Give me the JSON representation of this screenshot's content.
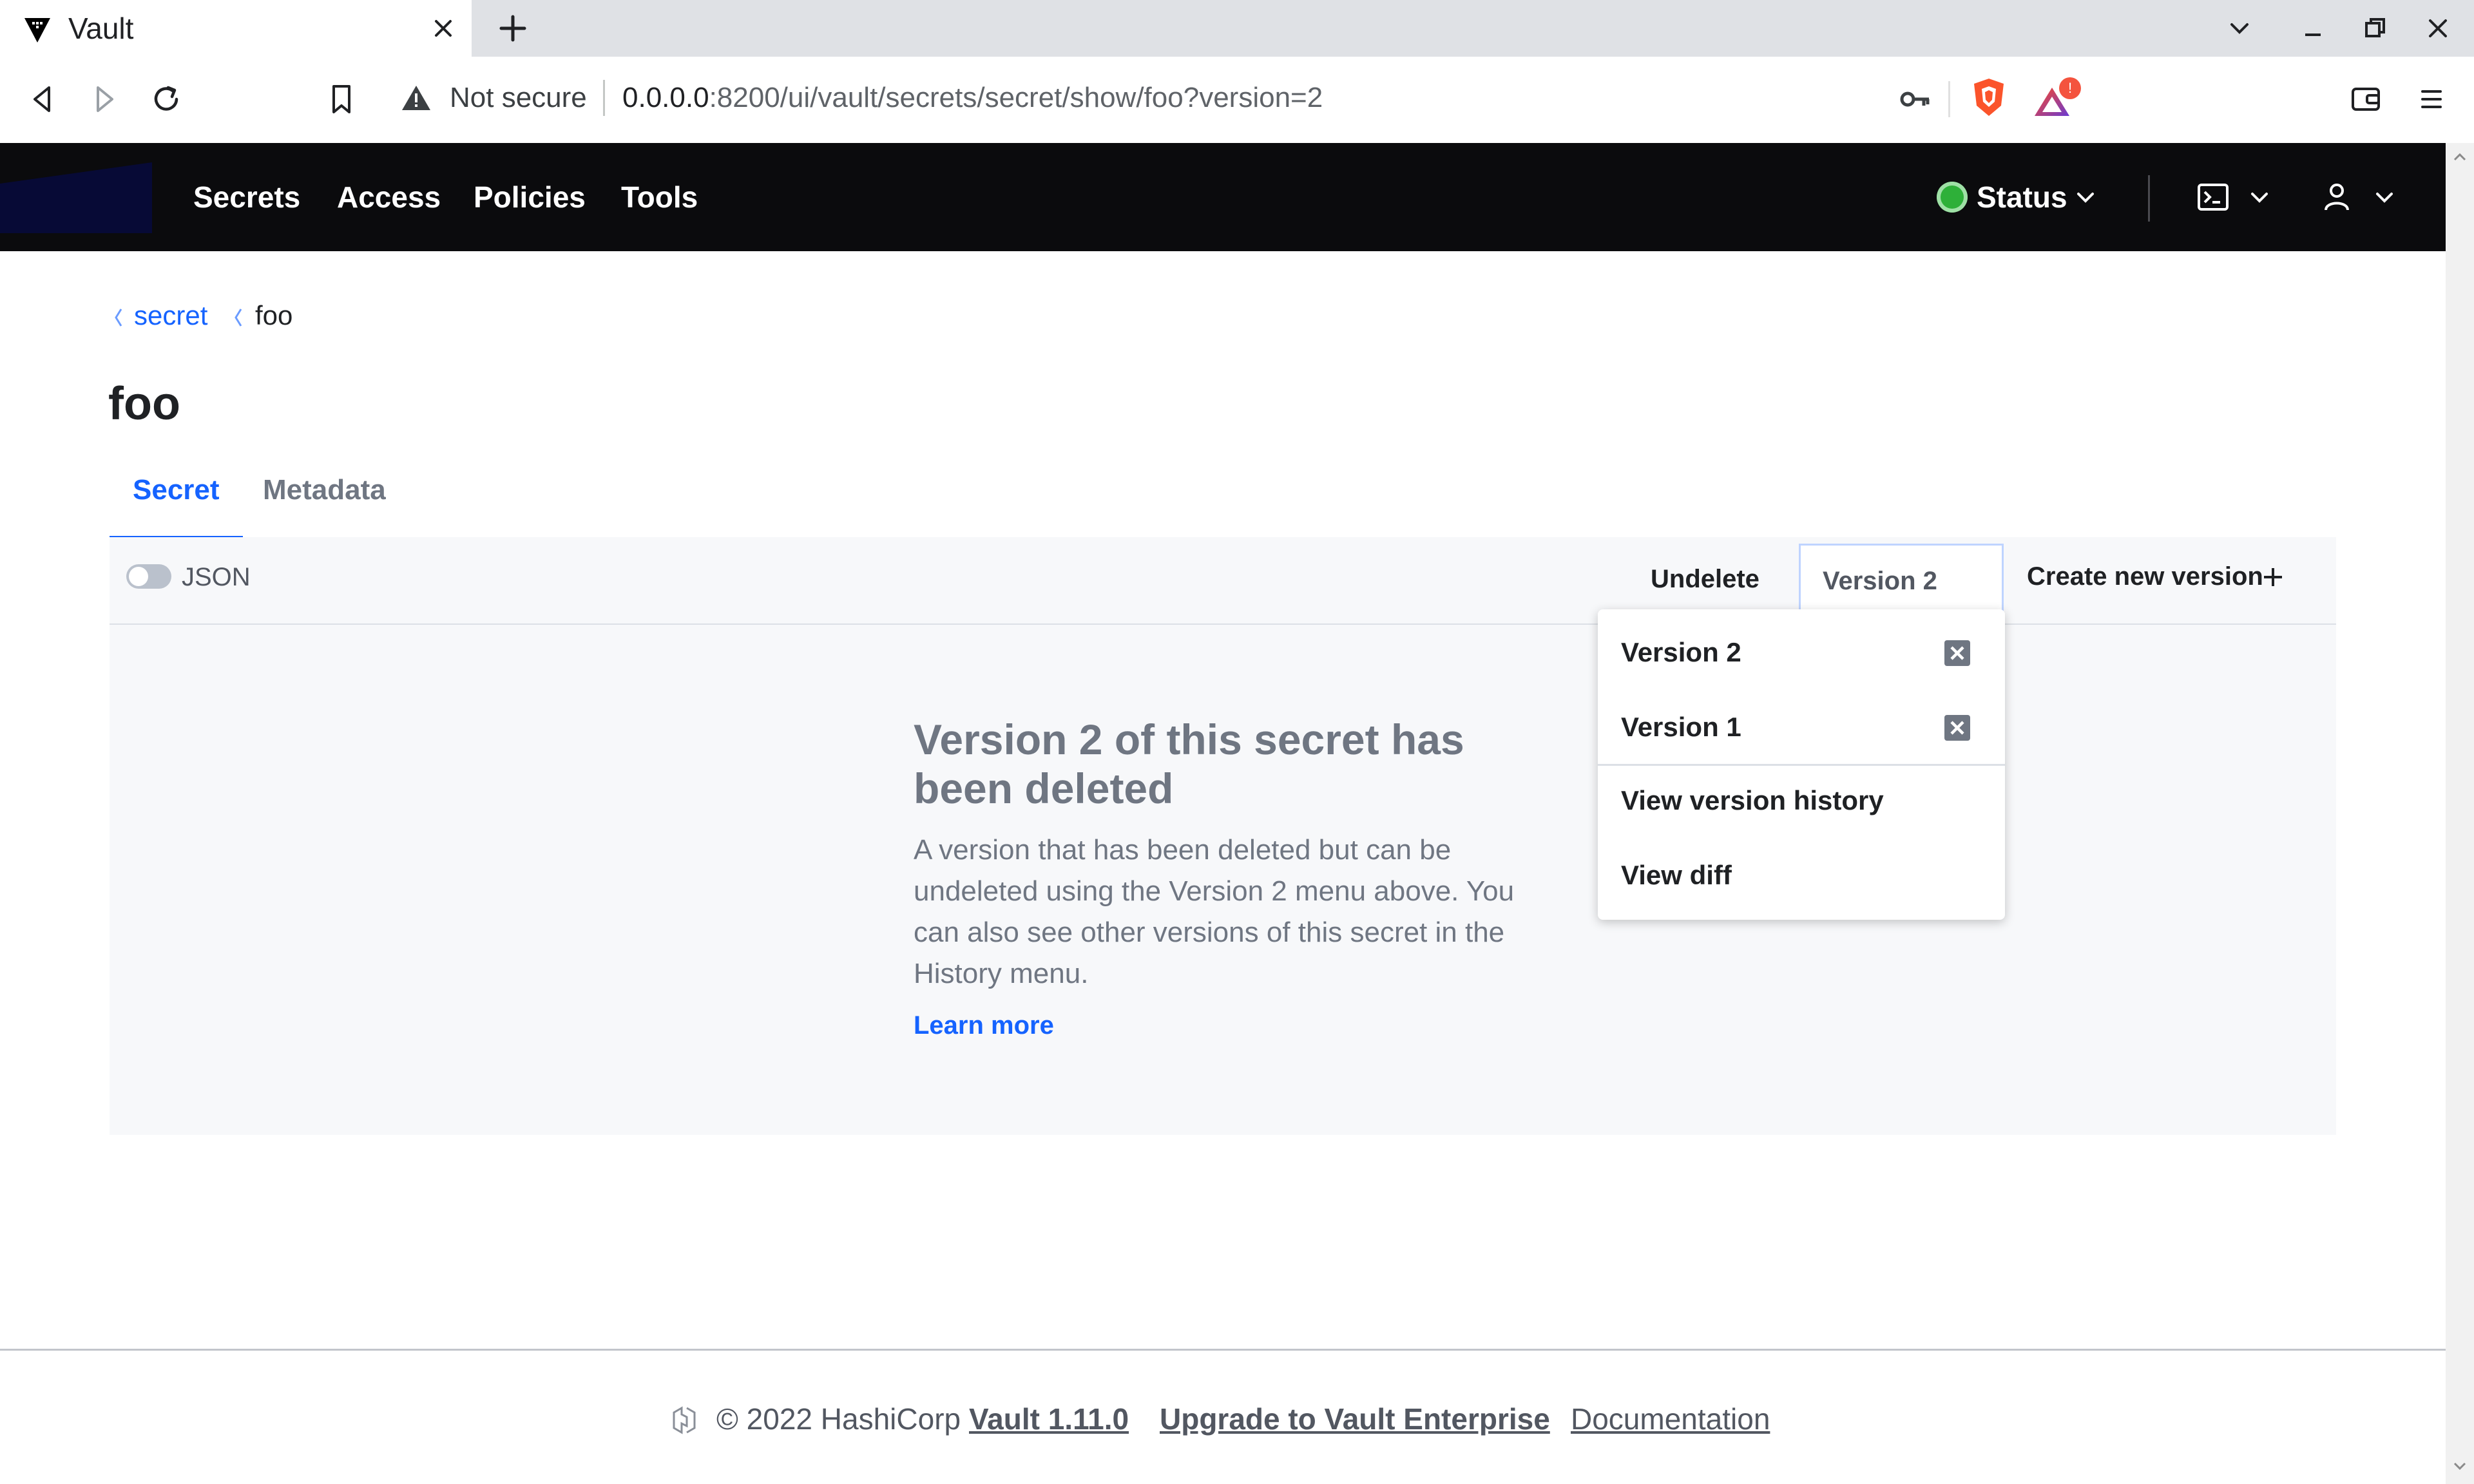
{
  "browser": {
    "tab_title": "Vault",
    "omnibox": {
      "security_label": "Not secure",
      "url_host": "0.0.0.0",
      "url_rest": ":8200/ui/vault/secrets/secret/show/foo?version=2",
      "rewards_badge": "!"
    }
  },
  "header": {
    "nav": [
      "Secrets",
      "Access",
      "Policies",
      "Tools"
    ],
    "status_label": "Status",
    "status_color": "#2eb039",
    "background": "#0b0b0d"
  },
  "breadcrumb": {
    "parent": "secret",
    "current": "foo"
  },
  "page": {
    "title": "foo",
    "tabs": [
      {
        "label": "Secret",
        "active": true
      },
      {
        "label": "Metadata",
        "active": false
      }
    ]
  },
  "toolbar": {
    "json_toggle_label": "JSON",
    "json_toggle_on": false,
    "undelete_label": "Undelete",
    "version_label": "Version 2",
    "create_label": "Create new version"
  },
  "version_menu": {
    "versions": [
      {
        "label": "Version 2",
        "deleted_icon": "close-box-icon"
      },
      {
        "label": "Version 1",
        "deleted_icon": "close-box-icon"
      }
    ],
    "history_label": "View version history",
    "diff_label": "View diff"
  },
  "empty_state": {
    "title": "Version 2 of this secret has been deleted",
    "body": "A version that has been deleted but can be undeleted using the Version 2 menu above. You can also see other versions of this secret in the History menu.",
    "link": "Learn more"
  },
  "footer": {
    "copyright": "© 2022 HashiCorp",
    "version": "Vault 1.11.0",
    "upgrade": "Upgrade to Vault Enterprise",
    "docs": "Documentation"
  },
  "colors": {
    "accent": "#1563ff",
    "muted_text": "#6f7682",
    "panel_bg": "#f7f8fa"
  }
}
